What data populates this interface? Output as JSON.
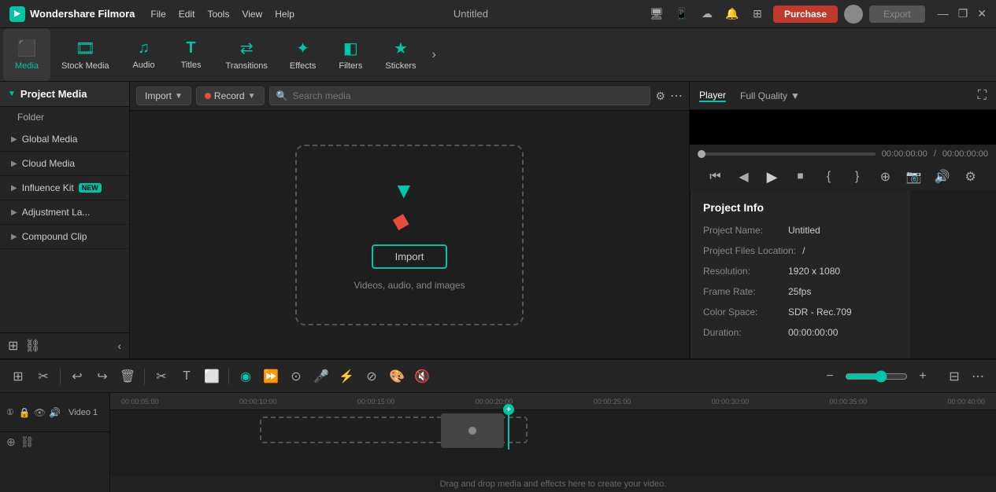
{
  "app": {
    "name": "Wondershare Filmora",
    "title": "Untitled"
  },
  "titlebar": {
    "menu": [
      "File",
      "Edit",
      "Tools",
      "View",
      "Help"
    ],
    "purchase_label": "Purchase",
    "export_label": "Export",
    "window_controls": [
      "—",
      "❐",
      "✕"
    ]
  },
  "toolbar": {
    "items": [
      {
        "id": "media",
        "label": "Media",
        "icon": "🎬"
      },
      {
        "id": "stock-media",
        "label": "Stock Media",
        "icon": "🎞"
      },
      {
        "id": "audio",
        "label": "Audio",
        "icon": "🎵"
      },
      {
        "id": "titles",
        "label": "Titles",
        "icon": "T"
      },
      {
        "id": "transitions",
        "label": "Transitions",
        "icon": "↔"
      },
      {
        "id": "effects",
        "label": "Effects",
        "icon": "✦"
      },
      {
        "id": "filters",
        "label": "Filters",
        "icon": "🔲"
      },
      {
        "id": "stickers",
        "label": "Stickers",
        "icon": "⭐"
      }
    ]
  },
  "sidebar": {
    "panel_title": "Project Media",
    "items": [
      {
        "label": "Folder"
      },
      {
        "label": "Global Media",
        "has_arrow": true
      },
      {
        "label": "Cloud Media",
        "has_arrow": true
      },
      {
        "label": "Influence Kit",
        "has_arrow": true,
        "badge": "NEW"
      },
      {
        "label": "Adjustment La...",
        "has_arrow": true
      },
      {
        "label": "Compound Clip",
        "has_arrow": true
      }
    ]
  },
  "media_toolbar": {
    "import_label": "Import",
    "record_label": "Record",
    "search_placeholder": "Search media"
  },
  "drop_zone": {
    "import_btn_label": "Import",
    "drop_label": "Videos, audio, and images"
  },
  "project_info": {
    "title": "Project Info",
    "fields": [
      {
        "label": "Project Name:",
        "value": "Untitled"
      },
      {
        "label": "Project Files Location:",
        "value": "/"
      },
      {
        "label": "Resolution:",
        "value": "1920 x 1080"
      },
      {
        "label": "Frame Rate:",
        "value": "25fps"
      },
      {
        "label": "Color Space:",
        "value": "SDR - Rec.709"
      },
      {
        "label": "Duration:",
        "value": "00:00:00:00"
      }
    ]
  },
  "player": {
    "tab_label": "Player",
    "quality_label": "Full Quality",
    "current_time": "00:00:00:00",
    "total_time": "00:00:00:00"
  },
  "timeline": {
    "ruler_marks": [
      "00:00:05:00",
      "00:00:10:00",
      "00:00:15:00",
      "00:00:20:00",
      "00:00:25:00",
      "00:00:30:00",
      "00:00:35:00",
      "00:00:40:00"
    ],
    "drop_hint": "Drag and drop media and effects here to create your video.",
    "track_name": "Video 1"
  }
}
